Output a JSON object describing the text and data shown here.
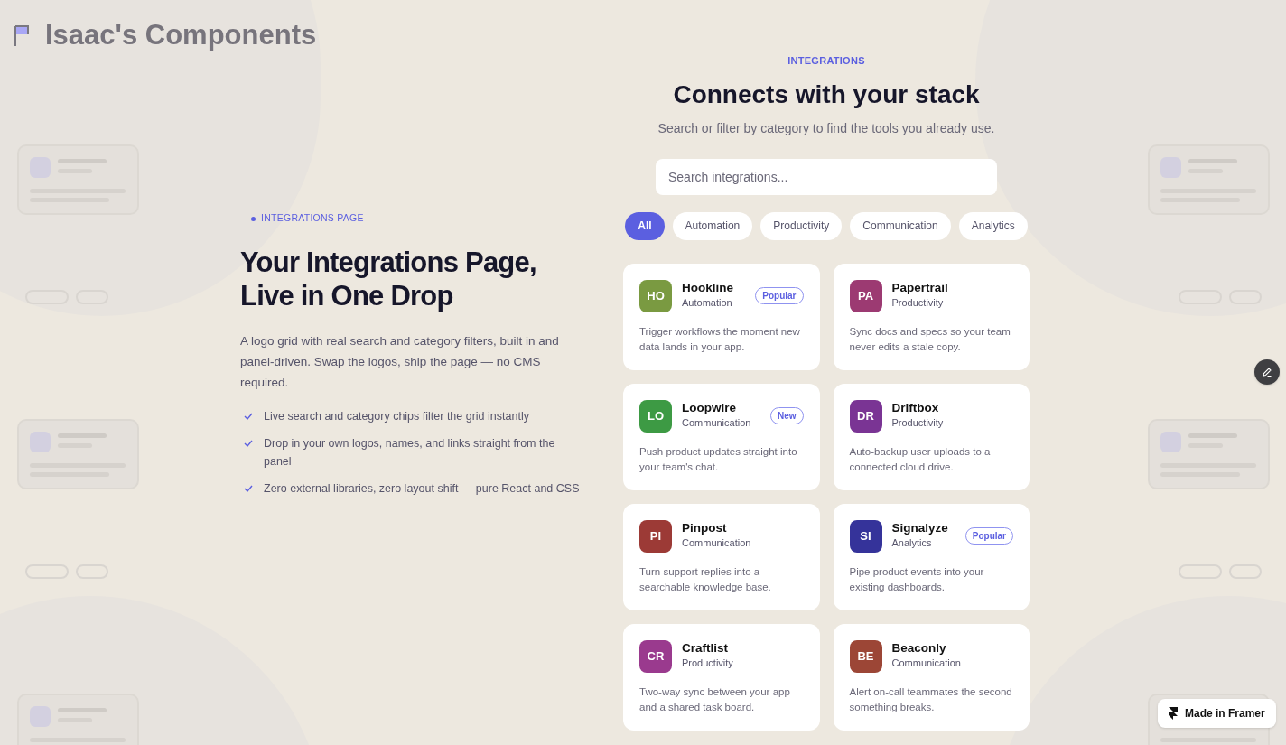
{
  "brand": {
    "title": "Isaac's Components"
  },
  "hero": {
    "eyebrow": "INTEGRATIONS PAGE",
    "title_lines": [
      "Your Integrations Page,",
      "Live in One Drop"
    ],
    "description": "A logo grid with real search and category filters, built in and panel-driven. Swap the logos, ship the page — no CMS required.",
    "features": [
      "Live search and category chips filter the grid instantly",
      "Drop in your own logos, names, and links straight from the panel",
      "Zero external libraries, zero layout shift — pure React and CSS"
    ]
  },
  "integrations": {
    "eyebrow": "INTEGRATIONS",
    "title": "Connects with your stack",
    "subtitle": "Search or filter by category to find the tools you already use.",
    "search": {
      "placeholder": "Search integrations..."
    },
    "filters": [
      {
        "label": "All",
        "selected": true
      },
      {
        "label": "Automation",
        "selected": false
      },
      {
        "label": "Productivity",
        "selected": false
      },
      {
        "label": "Communication",
        "selected": false
      },
      {
        "label": "Analytics",
        "selected": false
      }
    ],
    "cards": [
      {
        "initials": "HO",
        "color": "#7a9a41",
        "name": "Hookline",
        "category": "Automation",
        "badge": "Popular",
        "description": "Trigger workflows the moment new data lands in your app."
      },
      {
        "initials": "PA",
        "color": "#9c3a72",
        "name": "Papertrail",
        "category": "Productivity",
        "description": "Sync docs and specs so your team never edits a stale copy."
      },
      {
        "initials": "LO",
        "color": "#3d9a44",
        "name": "Loopwire",
        "category": "Communication",
        "badge": "New",
        "description": "Push product updates straight into your team's chat."
      },
      {
        "initials": "DR",
        "color": "#7a3494",
        "name": "Driftbox",
        "category": "Productivity",
        "description": "Auto-backup user uploads to a connected cloud drive."
      },
      {
        "initials": "PI",
        "color": "#9c3a36",
        "name": "Pinpost",
        "category": "Communication",
        "description": "Turn support replies into a searchable knowledge base."
      },
      {
        "initials": "SI",
        "color": "#35339a",
        "name": "Signalyze",
        "category": "Analytics",
        "badge": "Popular",
        "description": "Pipe product events into your existing dashboards."
      },
      {
        "initials": "CR",
        "color": "#9a3a8e",
        "name": "Craftlist",
        "category": "Productivity",
        "description": "Two-way sync between your app and a shared task board."
      },
      {
        "initials": "BE",
        "color": "#9c4636",
        "name": "Beaconly",
        "category": "Communication",
        "description": "Alert on-call teammates the second something breaks."
      }
    ]
  },
  "framer_badge": {
    "label": "Made in Framer"
  }
}
